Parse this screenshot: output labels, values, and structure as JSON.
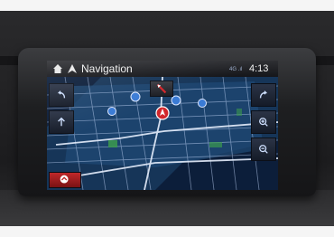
{
  "header": {
    "title": "Navigation",
    "time": "4:13",
    "signal": "4G .ıl"
  },
  "icons": {
    "home": "home-icon",
    "navi": "navigation-icon",
    "compass": "compass-icon",
    "back": "back-arrow-icon",
    "forward": "forward-arrow-icon",
    "up": "up-arrow-icon",
    "zoom_in": "zoom-in-icon",
    "zoom_out": "zoom-out-icon",
    "menu": "menu-chevron-icon"
  },
  "colors": {
    "map_water": "#0c1e3a",
    "map_land": "#1b3f66",
    "road": "#c8d7f0",
    "poi": "#3a7bd5",
    "vehicle": "#d2262b",
    "accent_red": "#c0282a"
  }
}
